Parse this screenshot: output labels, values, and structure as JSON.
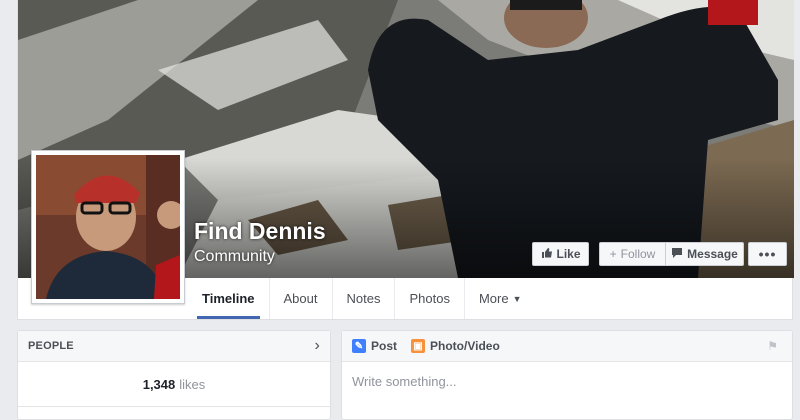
{
  "page": {
    "name": "Find Dennis",
    "category": "Community"
  },
  "actions": {
    "like_label": "Like",
    "follow_label": "Follow",
    "message_label": "Message",
    "more_label": "•••"
  },
  "tabs": [
    {
      "label": "Timeline",
      "active": true
    },
    {
      "label": "About"
    },
    {
      "label": "Notes"
    },
    {
      "label": "Photos"
    },
    {
      "label": "More"
    }
  ],
  "people": {
    "title": "PEOPLE",
    "likes_count": "1,348",
    "likes_label": "likes"
  },
  "composer": {
    "post_label": "Post",
    "photo_label": "Photo/Video",
    "placeholder": "Write something..."
  },
  "colors": {
    "accent": "#4267b2",
    "background": "#e9ebee"
  },
  "icons": {
    "like": "thumbs-up-icon",
    "follow": "plus-icon",
    "message": "speech-bubble-icon",
    "post": "pencil-icon",
    "photo": "photo-icon",
    "flag": "flag-icon",
    "chevron": "chevron-right-icon"
  }
}
